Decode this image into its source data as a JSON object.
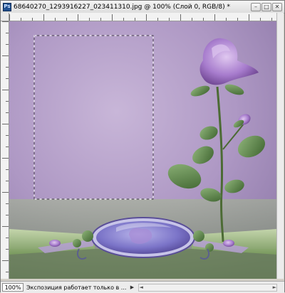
{
  "titlebar": {
    "app_icon": "Ps",
    "title": "68640270_1293916227_023411310.jpg @ 100% (Слой 0, RGB/8) *",
    "minimize": "–",
    "maximize": "□",
    "close": "✕"
  },
  "status": {
    "zoom": "100%",
    "message": "Экспозиция работает только в ...",
    "arrow": "▶",
    "hscroll_left": "◄",
    "hscroll_right": "►"
  },
  "colors": {
    "canvas_bg": "#b7a5c9",
    "selection": "#ffffff",
    "rose": "#9b6bc2",
    "leaf": "#4f7a3a",
    "ribbon": "#8fb06a",
    "oval_frame": "#7c7fbf"
  }
}
